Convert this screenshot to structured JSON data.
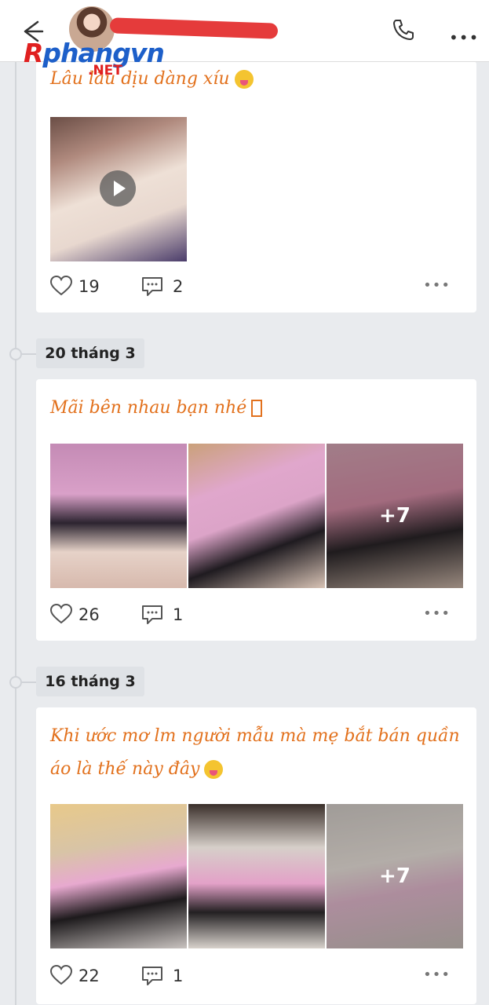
{
  "header": {
    "back_icon": "arrow-left-icon",
    "phone_icon": "phone-icon",
    "more_icon": "more-horizontal-icon",
    "more_glyph": "•••"
  },
  "watermark": {
    "logo_r": "R",
    "logo_rest": "phangvn",
    "logo_net": ".NET"
  },
  "posts": [
    {
      "caption": "Lâu lâu dịu dàng xíu",
      "media": "video",
      "likes": "19",
      "comments": "2",
      "more": "•••"
    },
    {
      "date": "20 tháng 3",
      "caption": "Mãi bên nhau bạn nhé",
      "media": "photos",
      "extra_count": "+7",
      "likes": "26",
      "comments": "1",
      "more": "•••"
    },
    {
      "date": "16 tháng 3",
      "caption_line1": "Khi ước mơ lm người mẫu mà mẹ bắt bán quần",
      "caption_line2": "áo là thế này đây",
      "media": "photos",
      "extra_count": "+7",
      "likes": "22",
      "comments": "1",
      "more": "•••"
    }
  ],
  "colors": {
    "caption": "#e2711d",
    "background": "#e9ebee",
    "card": "#ffffff",
    "redaction": "#e53b3b"
  }
}
